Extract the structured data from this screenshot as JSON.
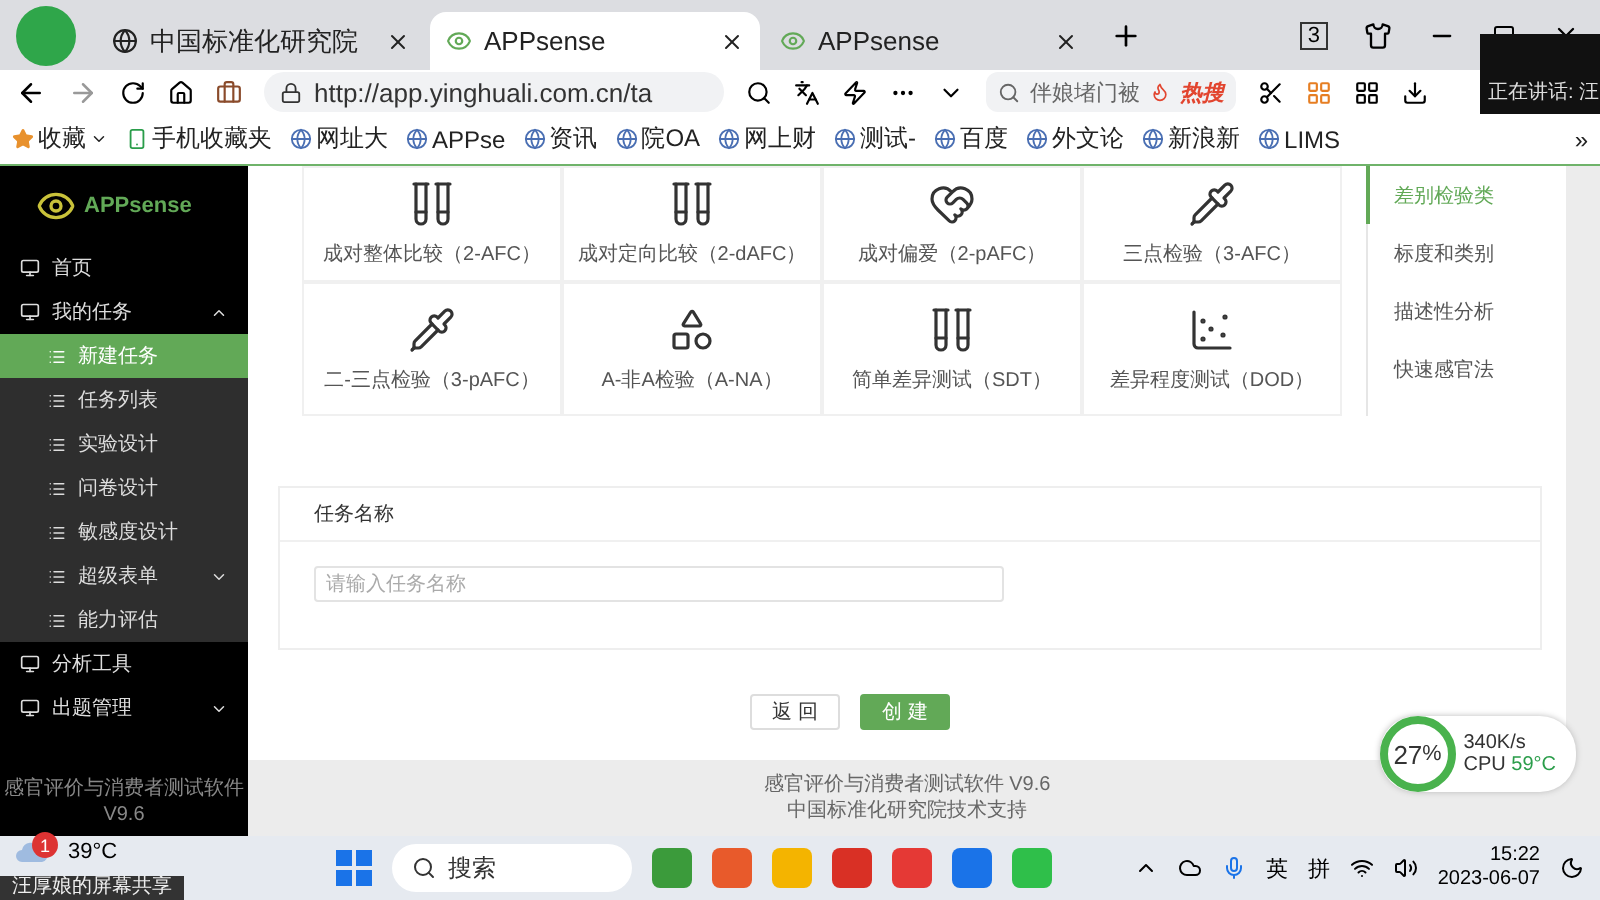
{
  "browser": {
    "tabs": [
      {
        "title": "中国标准化研究院",
        "selected": false
      },
      {
        "title": "APPsense",
        "selected": true
      },
      {
        "title": "APPsense",
        "selected": false
      }
    ],
    "tab_count": "3",
    "call_overlay": "正在讲话: 汪",
    "address": "http://app.yinghuali.com.cn/ta",
    "search": {
      "value": "伴娘堵门被",
      "hot": "热搜"
    },
    "bookmarks": [
      "收藏",
      "手机收藏夹",
      "网址大",
      "APPse",
      "资讯",
      "院OA",
      "网上财",
      "测试-",
      "百度",
      "外文论",
      "新浪新",
      "LIMS"
    ],
    "more": "»"
  },
  "sidebar": {
    "logo": "APPsense",
    "items": [
      {
        "label": "首页",
        "selected": false
      },
      {
        "label": "我的任务",
        "selected": false,
        "expanded": true,
        "children": [
          {
            "label": "新建任务",
            "selected": true
          },
          {
            "label": "任务列表",
            "selected": false
          },
          {
            "label": "实验设计",
            "selected": false
          },
          {
            "label": "问卷设计",
            "selected": false
          },
          {
            "label": "敏感度设计",
            "selected": false
          },
          {
            "label": "超级表单",
            "selected": false,
            "expanded": false
          },
          {
            "label": "能力评估",
            "selected": false
          }
        ]
      },
      {
        "label": "分析工具",
        "selected": false
      },
      {
        "label": "出题管理",
        "selected": false,
        "expanded": false
      }
    ],
    "footer": [
      "感官评价与消费者测试软件",
      "V9.6"
    ]
  },
  "tests": [
    {
      "label": "成对整体比较（2-AFC）"
    },
    {
      "label": "成对定向比较（2-dAFC）"
    },
    {
      "label": "成对偏爱（2-pAFC）"
    },
    {
      "label": "三点检验（3-AFC）"
    },
    {
      "label": "二-三点检验（3-pAFC）"
    },
    {
      "label": "A-非A检验（A-NA）"
    },
    {
      "label": "简单差异测试（SDT）"
    },
    {
      "label": "差异程度测试（DOD）"
    }
  ],
  "categories": [
    {
      "label": "差别检验类",
      "selected": true
    },
    {
      "label": "标度和类别",
      "selected": false
    },
    {
      "label": "描述性分析",
      "selected": false
    },
    {
      "label": "快速感官法",
      "selected": false
    }
  ],
  "form": {
    "title": "任务名称",
    "placeholder": "请输入任务名称"
  },
  "buttons": {
    "back": "返 回",
    "create": "创 建"
  },
  "footer": [
    "感官评价与消费者测试软件 V9.6",
    "中国标准化研究院技术支持"
  ],
  "monitor": {
    "percent": "27",
    "unit": "%",
    "speed": "340K/s",
    "cpu": "CPU",
    "temp": "59°C"
  },
  "taskbar": {
    "temp": "39°C",
    "badge": "1",
    "share": "汪厚娘的屏幕共享",
    "search": "搜索",
    "ime": [
      "英",
      "拼"
    ],
    "time": "15:22",
    "date": "2023-06-07"
  }
}
